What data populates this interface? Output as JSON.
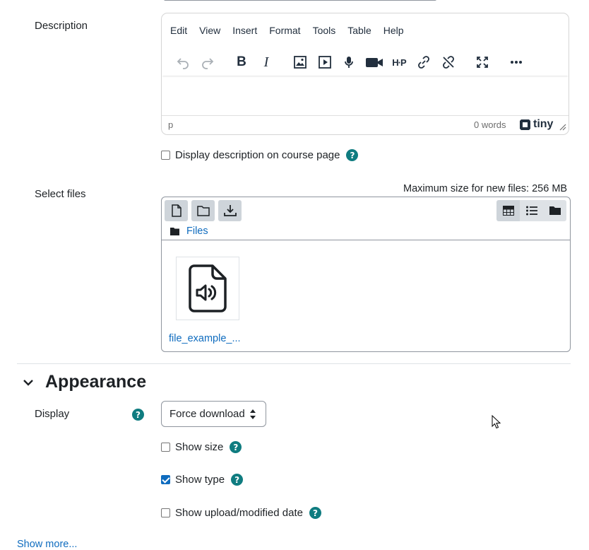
{
  "description": {
    "label": "Description",
    "menu": [
      "Edit",
      "View",
      "Insert",
      "Format",
      "Tools",
      "Table",
      "Help"
    ],
    "toolbar_icons": [
      "undo-icon",
      "redo-icon",
      "bold-icon",
      "italic-icon",
      "image-icon",
      "media-icon",
      "record-audio-icon",
      "record-video-icon",
      "h5p-icon",
      "link-icon",
      "unlink-icon",
      "fullscreen-icon",
      "more-icon"
    ],
    "status_path": "p",
    "word_count": "0 words",
    "brand": "tiny"
  },
  "display_description": {
    "label": "Display description on course page",
    "checked": false
  },
  "select_files": {
    "label": "Select files",
    "max_size": "Maximum size for new files: 256 MB",
    "path": "Files",
    "file_name": "file_example_..."
  },
  "appearance": {
    "heading": "Appearance",
    "display_label": "Display",
    "display_value": "Force download",
    "options": [
      {
        "label": "Show size",
        "checked": false
      },
      {
        "label": "Show type",
        "checked": true
      },
      {
        "label": "Show upload/modified date",
        "checked": false
      }
    ],
    "show_more": "Show more..."
  },
  "colors": {
    "help_icon": "#0f7c80",
    "link": "#0f6cbf",
    "checkbox": "#0f6cbf"
  }
}
